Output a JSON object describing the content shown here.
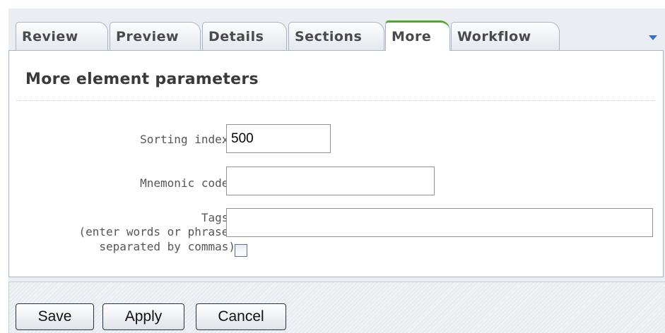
{
  "tabs": [
    {
      "label": "Review",
      "active": false
    },
    {
      "label": "Preview",
      "active": false
    },
    {
      "label": "Details",
      "active": false
    },
    {
      "label": "Sections",
      "active": false
    },
    {
      "label": "More",
      "active": true
    },
    {
      "label": "Workflow",
      "active": false
    }
  ],
  "tab_menu_icon": "chevron-down-icon",
  "panel": {
    "title": "More element parameters",
    "fields": {
      "sorting_index": {
        "label": "Sorting index:",
        "value": "500"
      },
      "mnemonic_code": {
        "label": "Mnemonic code:",
        "value": ""
      },
      "tags": {
        "label_line1": "Tags:",
        "label_line2": "(enter words or phrases",
        "label_line3": "separated by commas)",
        "value": "",
        "checkbox_checked": false
      }
    }
  },
  "buttons": {
    "save": "Save",
    "apply": "Apply",
    "cancel": "Cancel"
  },
  "colors": {
    "active_tab_accent": "#4fa82e",
    "menu_arrow": "#2f6fcd",
    "frame_background": "#eaeef3"
  }
}
